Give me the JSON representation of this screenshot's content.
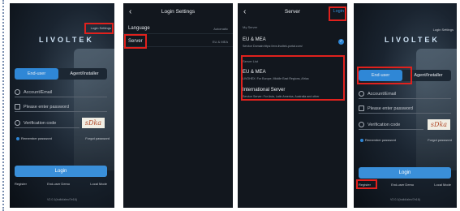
{
  "p1": {
    "login_settings": "Login Settings",
    "logo": "LIVOLTEK",
    "tab_enduser": "End-user",
    "tab_agent": "Agent/Installer",
    "account_placeholder": "Account/Email",
    "password_placeholder": "Please enter password",
    "verification_label": "Verification code",
    "captcha": "sDka",
    "remember": "Remember password",
    "forgot": "Forgot password",
    "login": "Login",
    "register": "Register",
    "demo": "End-user Demo",
    "local": "Local Mode",
    "version": "V2.0.1(build/alex/7e16)"
  },
  "p2": {
    "title": "Login Settings",
    "rows": [
      {
        "label": "Language",
        "value": "Automatic"
      },
      {
        "label": "Server",
        "value": "EU & MEA"
      }
    ]
  },
  "p3": {
    "title": "Server",
    "save": "Login",
    "my_server": "My Server",
    "current_name": "EU & MEA",
    "current_desc": "Service Domain:https://evs.livoltek-portal.com/",
    "server_list": "Server List",
    "list": [
      {
        "name": "EU & MEA",
        "desc": "LIVOHEX: For Europe, Middle East Regions, Africa"
      },
      {
        "name": "International Server",
        "desc": "Service Server: For Asia, Latin America, Australia and other"
      }
    ]
  },
  "p4": {
    "login_settings": "Login Settings",
    "logo": "LIVOLTEK",
    "tab_enduser": "End-user",
    "tab_agent": "Agent/Installer",
    "account_placeholder": "Account/Email",
    "password_placeholder": "Please enter password",
    "verification_label": "Verification code",
    "captcha": "sDka",
    "remember": "Remember password",
    "forgot": "Forgot password",
    "login": "Login",
    "register": "Register",
    "demo": "End-user Demo",
    "local": "Local Mode",
    "version": "V2.0.1(build/alex/7e16)"
  },
  "colors": {
    "highlight": "#e0211d",
    "accent": "#2f87d6"
  }
}
